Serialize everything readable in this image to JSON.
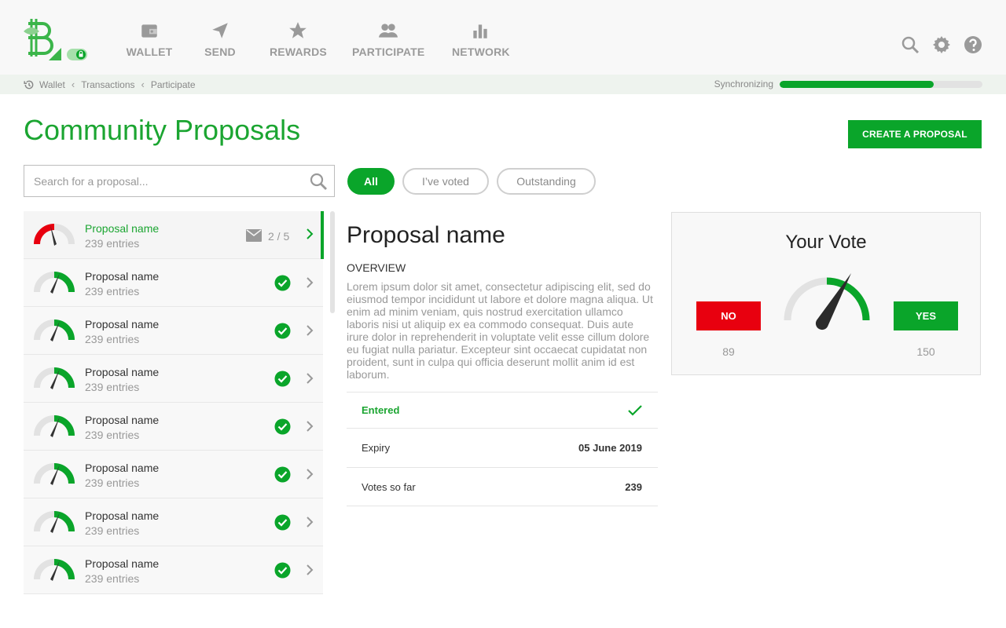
{
  "nav": {
    "items": [
      {
        "label": "WALLET",
        "icon": "wallet-icon"
      },
      {
        "label": "SEND",
        "icon": "send-icon"
      },
      {
        "label": "REWARDS",
        "icon": "star-icon"
      },
      {
        "label": "PARTICIPATE",
        "icon": "people-icon"
      },
      {
        "label": "NETWORK",
        "icon": "bar-chart-icon"
      }
    ],
    "right_icons": [
      "search-icon",
      "gear-icon",
      "help-icon"
    ]
  },
  "breadcrumb": {
    "items": [
      "Wallet",
      "Transactions",
      "Participate"
    ]
  },
  "sync": {
    "label": "Synchronizing",
    "progress": 0.76
  },
  "page": {
    "title": "Community Proposals",
    "create_button": "CREATE A PROPOSAL"
  },
  "search": {
    "placeholder": "Search for a proposal..."
  },
  "filters": [
    {
      "label": "All",
      "active": true
    },
    {
      "label": "I’ve voted",
      "active": false
    },
    {
      "label": "Outstanding",
      "active": false
    }
  ],
  "proposals": [
    {
      "name": "Proposal name",
      "entries": "239 entries",
      "ratio": "2 / 5",
      "selected": true
    },
    {
      "name": "Proposal name",
      "entries": "239 entries"
    },
    {
      "name": "Proposal name",
      "entries": "239 entries"
    },
    {
      "name": "Proposal name",
      "entries": "239 entries"
    },
    {
      "name": "Proposal name",
      "entries": "239 entries"
    },
    {
      "name": "Proposal name",
      "entries": "239 entries"
    },
    {
      "name": "Proposal name",
      "entries": "239 entries"
    },
    {
      "name": "Proposal name",
      "entries": "239 entries"
    }
  ],
  "detail": {
    "title": "Proposal name",
    "overview_label": "OVERVIEW",
    "body": "Lorem ipsum dolor sit amet, consectetur adipiscing elit, sed do eiusmod tempor incididunt ut labore et dolore magna aliqua. Ut enim ad minim veniam, quis nostrud exercitation ullamco laboris nisi ut aliquip ex ea commodo consequat. Duis aute irure dolor in reprehenderit in voluptate velit esse cillum dolore eu fugiat nulla pariatur. Excepteur sint occaecat cupidatat non proident, sunt in culpa qui officia deserunt mollit anim id est laborum.",
    "rows": {
      "entered": "Entered",
      "expiry_label": "Expiry",
      "expiry_value": "05 June 2019",
      "votes_label": "Votes so far",
      "votes_value": "239"
    }
  },
  "vote": {
    "title": "Your Vote",
    "no_label": "NO",
    "yes_label": "YES",
    "no_count": "89",
    "yes_count": "150"
  },
  "colors": {
    "brand_green": "#0aa52a",
    "title_green": "#1ba531",
    "no_red": "#e8000f",
    "nav_gray": "#9a9a9a"
  }
}
